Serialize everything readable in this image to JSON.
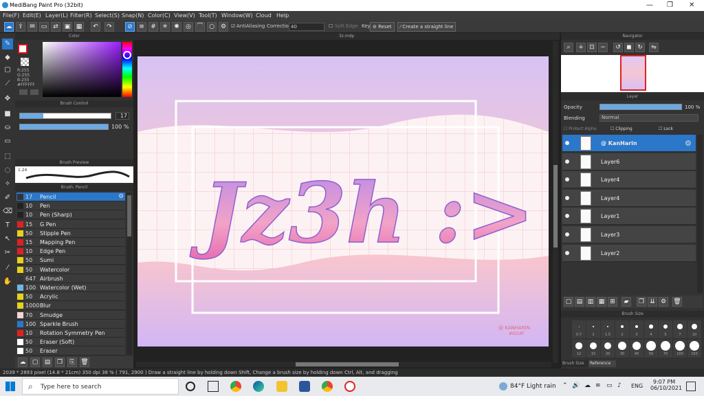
{
  "window": {
    "title": "MediBang Paint Pro (32bit)"
  },
  "menu": [
    "File(F)",
    "Edit(E)",
    "Layer(L)",
    "Filter(R)",
    "Select(S)",
    "Snap(N)",
    "Color(C)",
    "View(V)",
    "Tool(T)",
    "Window(W)",
    "Cloud",
    "Help"
  ],
  "toolbar": {
    "antialias_label": "AntiAliasing",
    "correction_label": "Correction",
    "correction_value": "40",
    "soft_edge_label": "Soft Edge",
    "key_label": "Key",
    "reset_label": "Reset",
    "straight_line_label": "Create a straight line"
  },
  "color_panel": {
    "title": "Color",
    "rgb": [
      "R:255",
      "G:255",
      "B:255"
    ],
    "hex": "#FFFFFF"
  },
  "brush_control": {
    "title": "Brush Control",
    "size_value": "17",
    "opacity_value": "100 %",
    "size_fraction": 0.26,
    "opacity_fraction": 1.0
  },
  "brush_preview": {
    "title": "Brush Preview",
    "size_label": "1.24"
  },
  "brush_list": {
    "title": "Brush: Pencil",
    "items": [
      {
        "size": "17",
        "name": "Pencil",
        "color": "#333333"
      },
      {
        "size": "10",
        "name": "Pen",
        "color": "#222222"
      },
      {
        "size": "10",
        "name": "Pen (Sharp)",
        "color": "#222222"
      },
      {
        "size": "15",
        "name": "G Pen",
        "color": "#e02020"
      },
      {
        "size": "50",
        "name": "Stipple Pen",
        "color": "#e6d21a"
      },
      {
        "size": "15",
        "name": "Mapping Pen",
        "color": "#e02020"
      },
      {
        "size": "10",
        "name": "Edge Pen",
        "color": "#e02020"
      },
      {
        "size": "50",
        "name": "Sumi",
        "color": "#e6d21a"
      },
      {
        "size": "50",
        "name": "Watercolor",
        "color": "#e6d21a"
      },
      {
        "size": "647",
        "name": "Airbrush",
        "color": "#333333"
      },
      {
        "size": "100",
        "name": "Watercolor (Wet)",
        "color": "#6fb6e6"
      },
      {
        "size": "50",
        "name": "Acrylic",
        "color": "#e6d21a"
      },
      {
        "size": "1000",
        "name": "Blur",
        "color": "#e6d21a"
      },
      {
        "size": "70",
        "name": "Smudge",
        "color": "#f2d6d6"
      },
      {
        "size": "100",
        "name": "Sparkle Brush",
        "color": "#2b77c9"
      },
      {
        "size": "10",
        "name": "Rotation Symmetry Pen",
        "color": "#e02020"
      },
      {
        "size": "50",
        "name": "Eraser (Soft)",
        "color": "#ffffff"
      },
      {
        "size": "50",
        "name": "Eraser",
        "color": "#ffffff"
      }
    ]
  },
  "canvas": {
    "tab": "3z.mdp",
    "artwork_text": "Jz3h :>",
    "watermark": [
      "@ KANHARIN",
      "#ID2AT"
    ]
  },
  "navigator": {
    "title": "Navigator"
  },
  "layer_panel": {
    "title": "Layer",
    "opacity_label": "Opacity",
    "opacity_value": "100 %",
    "blending_label": "Blending",
    "blending_value": "Normal",
    "protect_alpha": "Protect Alpha",
    "clipping": "Clipping",
    "lock": "Lock",
    "layers": [
      {
        "name": "@ KanHarin",
        "selected": true
      },
      {
        "name": "Layer6"
      },
      {
        "name": "Layer4"
      },
      {
        "name": "Layer4"
      },
      {
        "name": "Layer1"
      },
      {
        "name": "Layer3"
      },
      {
        "name": "Layer2"
      }
    ]
  },
  "brush_size": {
    "title": "Brush Size",
    "sizes": [
      "0.7",
      "1",
      "1.5",
      "2",
      "3",
      "4",
      "5",
      "7",
      "10",
      "12",
      "15",
      "20",
      "30",
      "40",
      "50",
      "70",
      "100",
      "150"
    ],
    "tabs": [
      "Brush Size",
      "Reference"
    ]
  },
  "status": {
    "text": "2039 * 2893 pixel  (14.8 * 21cm)  350 dpi  38 %  ( 791, 2900 )  Draw a straight line by holding down Shift, Change a brush size by holding down Ctrl, Alt, and dragging"
  },
  "taskbar": {
    "search_placeholder": "Type here to search",
    "weather": "84°F  Light rain",
    "lang": "ENG",
    "time": "9:07 PM",
    "date": "06/10/2021"
  }
}
